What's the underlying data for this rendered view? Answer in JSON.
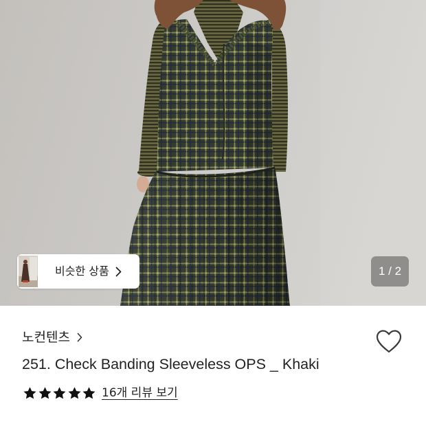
{
  "gallery": {
    "similar_products": {
      "label": "비슷한 상품",
      "icon": "chevron-right-icon"
    },
    "page_indicator": "1 / 2"
  },
  "product": {
    "brand": {
      "name": "노컨텐츠",
      "icon": "chevron-right-icon"
    },
    "wishlist_icon": "heart-outline-icon",
    "title": "251. Check Banding Sleeveless OPS _ Khaki",
    "rating": {
      "value": 5,
      "max": 5,
      "icon": "star-icon"
    },
    "review_link": "16개 리뷰 보기"
  },
  "colors": {
    "text_primary": "#222222",
    "star_filled": "#111111",
    "star_empty": "#dddddd",
    "page_background": "#ffffff"
  }
}
